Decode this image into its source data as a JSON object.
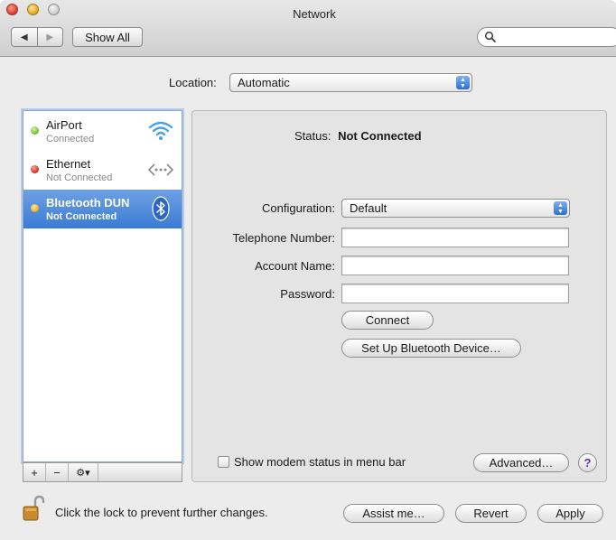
{
  "window": {
    "title": "Network"
  },
  "toolbar": {
    "back_glyph": "◀",
    "forward_glyph": "▶",
    "show_all_label": "Show All",
    "search_placeholder": "",
    "search_icon": "search-icon"
  },
  "location": {
    "label": "Location:",
    "value": "Automatic"
  },
  "services": [
    {
      "name": "AirPort",
      "status": "Connected",
      "dot_color": "#7cc242",
      "icon": "wifi-icon",
      "selected": false
    },
    {
      "name": "Ethernet",
      "status": "Not Connected",
      "dot_color": "#d9342b",
      "icon": "ethernet-icon",
      "selected": false
    },
    {
      "name": "Bluetooth DUN",
      "status": "Not Connected",
      "dot_color": "#f0b429",
      "icon": "bluetooth-icon",
      "selected": true
    }
  ],
  "list_bar": {
    "add": "+",
    "remove": "−",
    "gear": "⚙▾"
  },
  "detail": {
    "status_label": "Status:",
    "status_value": "Not Connected",
    "configuration_label": "Configuration:",
    "configuration_value": "Default",
    "telephone_label": "Telephone Number:",
    "telephone_value": "",
    "account_label": "Account Name:",
    "account_value": "",
    "password_label": "Password:",
    "password_value": "",
    "connect_label": "Connect",
    "setup_label": "Set Up Bluetooth Device…",
    "modem_status_label": "Show modem status in menu bar",
    "modem_status_checked": false,
    "advanced_label": "Advanced…",
    "help_label": "?"
  },
  "footer": {
    "lock_text": "Click the lock to prevent further changes.",
    "assist_label": "Assist me…",
    "revert_label": "Revert",
    "apply_label": "Apply"
  },
  "colors": {
    "selection": "#3a7bd5",
    "popup_arrow": "#2a6fd4"
  }
}
